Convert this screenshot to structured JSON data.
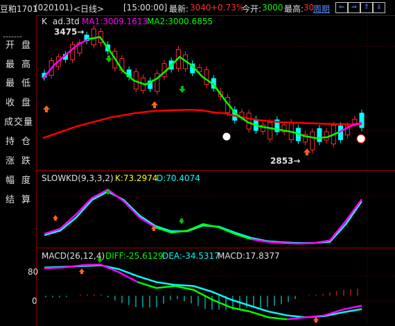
{
  "topbar": {
    "name": "豆粕1701",
    "code": "(020101)",
    "period": "<日线>",
    "time": "[15:00:00]",
    "latest_label": "最新:",
    "latest_value": "3040",
    "change": "+0.73%",
    "open_label": "今开:",
    "open_value": "3000",
    "high_label": "最高:",
    "high_value": "30",
    "cycle_label": "周期",
    "colors": {
      "up": "#ff3030",
      "text": "#c0c0c0",
      "green": "#00ff00",
      "blue": "#5a8cff"
    }
  },
  "sidebar": {
    "dash": "-------",
    "items": [
      {
        "label": "开盘",
        "icon": ""
      },
      {
        "label": "最高",
        "icon": ""
      },
      {
        "label": "最低",
        "icon": ""
      },
      {
        "label": "收盘",
        "icon": ""
      },
      {
        "label": "成交量",
        "icon": ""
      },
      {
        "label": "持仓",
        "icon": ""
      },
      {
        "label": "涨跌",
        "icon": ""
      },
      {
        "label": "幅度",
        "icon": ""
      },
      {
        "label": "结算",
        "icon": ""
      }
    ]
  },
  "main_panel": {
    "kline_label": "K",
    "ad_label": "ad.3td",
    "ma1": "MA1:3009.1613",
    "ma2": "MA2:3000.6855",
    "high_annot": "3475→",
    "low_annot": "2853→"
  },
  "kd_panel": {
    "title": "SLOWKD(9,3,3,2)",
    "k": "K:73.2974",
    "d": "D:70.4074"
  },
  "macd_panel": {
    "title": "MACD(26,12,4)",
    "diff": "DIFF:-25.6129",
    "dea": "DEA:-34.5317",
    "macd": "MACD:17.8377",
    "axis_80": "80",
    "axis_0": "0"
  },
  "chart_data": [
    {
      "type": "candlestick",
      "series": [
        {
          "name": "MA1",
          "values": [
            3230,
            3300,
            3350,
            3400,
            3430,
            3440,
            3360,
            3270,
            3220,
            3200,
            3230,
            3280,
            3340,
            3300,
            3240,
            3200,
            3120,
            3050,
            3010,
            2990,
            2980,
            2970,
            2960,
            2940,
            2930,
            2935,
            2960,
            2990,
            3009
          ]
        },
        {
          "name": "MA2",
          "values": [
            2930,
            2950,
            2970,
            2990,
            3005,
            3020,
            3035,
            3045,
            3055,
            3062,
            3068,
            3070,
            3072,
            3073,
            3070,
            3060,
            3055,
            3040,
            3030,
            3020,
            3015,
            3010,
            3008,
            3006,
            3004,
            3002,
            3001,
            3000,
            3000
          ]
        }
      ],
      "ylim": [
        2850,
        3480
      ]
    },
    {
      "type": "line",
      "series": [
        {
          "name": "K",
          "values": [
            20,
            28,
            50,
            75,
            88,
            70,
            45,
            30,
            22,
            25,
            35,
            30,
            20,
            12,
            8,
            6,
            5,
            6,
            10,
            40,
            73
          ]
        },
        {
          "name": "D",
          "values": [
            18,
            25,
            45,
            72,
            85,
            72,
            48,
            32,
            24,
            24,
            33,
            31,
            22,
            14,
            9,
            7,
            6,
            6,
            8,
            35,
            70
          ]
        }
      ],
      "ylim": [
        0,
        100
      ]
    },
    {
      "type": "line",
      "series": [
        {
          "name": "DIFF",
          "values": [
            70,
            72,
            78,
            80,
            60,
            35,
            20,
            25,
            15,
            -10,
            -30,
            -40,
            -55,
            -60,
            -55,
            -50,
            -35,
            -25
          ]
        },
        {
          "name": "DEA",
          "values": [
            72,
            74,
            76,
            78,
            68,
            50,
            35,
            28,
            25,
            10,
            -10,
            -25,
            -40,
            -50,
            -55,
            -52,
            -42,
            -34
          ]
        }
      ],
      "ylim": [
        -70,
        100
      ]
    }
  ]
}
